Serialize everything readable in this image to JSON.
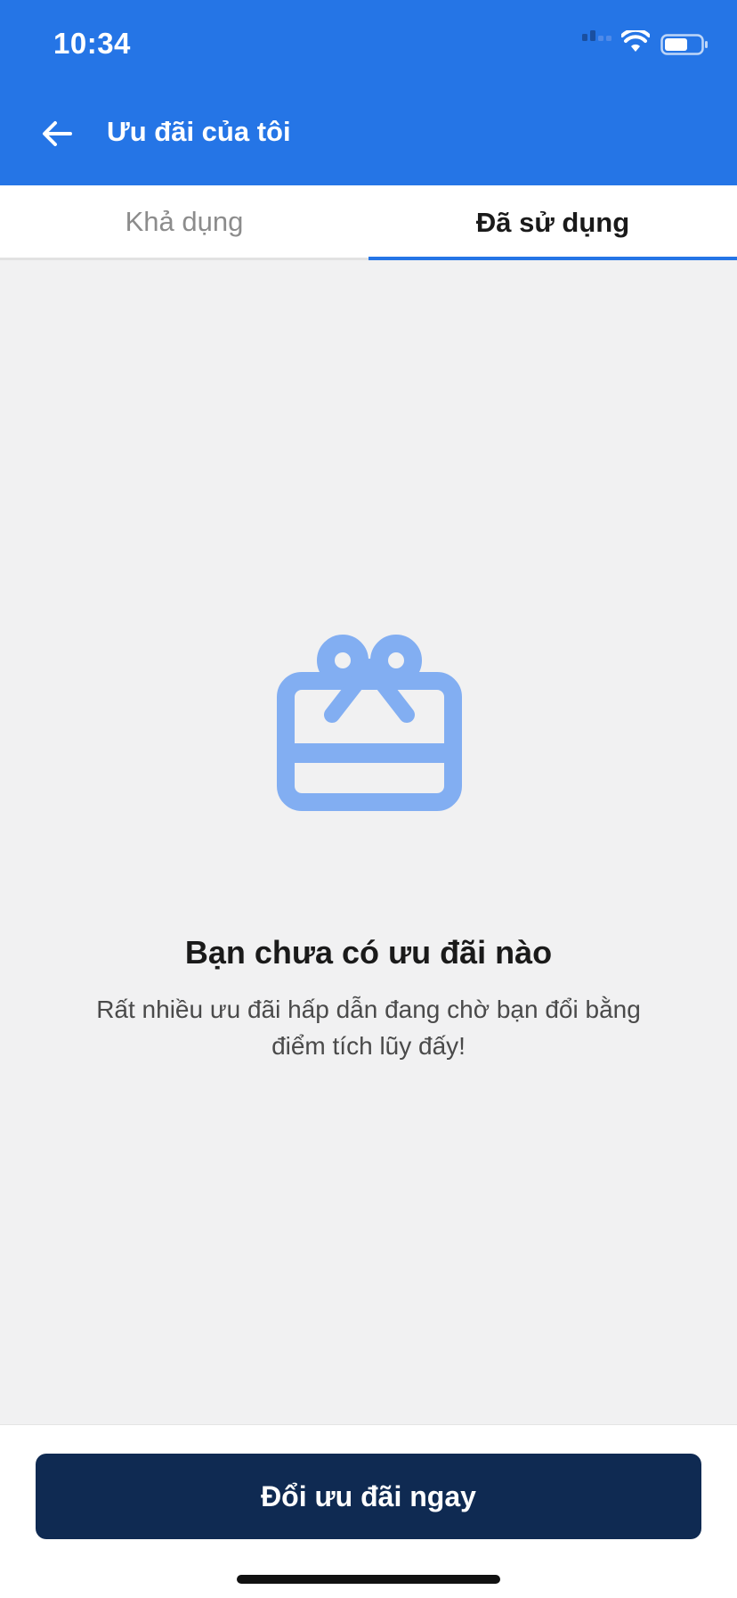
{
  "status_bar": {
    "time": "10:34",
    "icons": [
      "cellular-signal-icon",
      "wifi-icon",
      "battery-icon"
    ]
  },
  "header": {
    "back_icon": "arrow-left-icon",
    "title": "Ưu đãi của tôi",
    "background_color": "#2575e6"
  },
  "tabs": [
    {
      "label": "Khả dụng",
      "selected": false
    },
    {
      "label": "Đã sử dụng",
      "selected": true
    }
  ],
  "empty_state": {
    "icon": "gift-card-icon",
    "icon_color": "#82aef2",
    "title": "Bạn chưa có ưu đãi nào",
    "description": "Rất nhiều ưu đãi hấp dẫn đang chờ bạn đổi bằng điểm tích lũy đấy!"
  },
  "footer": {
    "button_label": "Đổi ưu đãi ngay",
    "button_color": "#0f2a52"
  }
}
